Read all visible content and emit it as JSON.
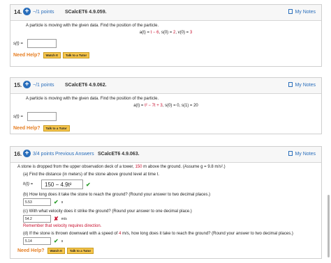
{
  "q14": {
    "num": "14.",
    "points": "−/1 points",
    "code": "SCalcET6 4.9.059.",
    "notes": "My Notes",
    "prompt": "A particle is moving with the given data. Find the position of the particle.",
    "eq_prefix": "a(t) = ",
    "eq_red1": "t − 6",
    "eq_mid": ",   s(0) = ",
    "eq_red2": "2",
    "eq_mid2": ",   v(0) = ",
    "eq_red3": "3",
    "ans_label": "s(t) =",
    "help": "Need Help?",
    "btn1": "Watch It",
    "btn2": "Talk to a Tutor"
  },
  "q15": {
    "num": "15.",
    "points": "−/1 points",
    "code": "SCalcET6 4.9.062.",
    "notes": "My Notes",
    "prompt": "A particle is moving with the given data. Find the position of the particle.",
    "eq_prefix": "a(t) = ",
    "eq_red1": "t² − 7t + 3",
    "eq_mid": ",   s(0) = 0,   s(1) = 20",
    "ans_label": "s(t) =",
    "help": "Need Help?",
    "btn1": "Talk to a Tutor"
  },
  "q16": {
    "num": "16.",
    "points": "3/4 points",
    "prev": "Previous Answers",
    "code": "SCalcET6 4.9.063.",
    "notes": "My Notes",
    "prompt_a": "A stone is dropped from the upper observation deck of a tower, ",
    "prompt_red": "150",
    "prompt_b": " m above the ground. (Assume g = 9.8 m/s².)",
    "pa": "(a) Find the distance (in meters) of the stone above ground level at time t.",
    "h_label": "h(t) =",
    "h_value": "150 − 4.9t²",
    "pb": "(b) How long does it take the stone to reach the ground? (Round your answer to two decimal places.)",
    "b_value": "5.53",
    "b_unit": "s",
    "pc": "(c) With what velocity does it strike the ground? (Round your answer to one decimal place.)",
    "c_value": "54.2",
    "c_unit": "m/s",
    "c_hint": "Remember that velocity requires direction.",
    "pd_a": "(d) If the stone is thrown downward with a speed of ",
    "pd_red": "4",
    "pd_b": " m/s, how long does it take to reach the ground? (Round your answer to two decimal places.)",
    "d_value": "5.14",
    "d_unit": "s",
    "help": "Need Help?",
    "btn1": "Watch It",
    "btn2": "Talk to a Tutor"
  },
  "icons": {
    "check": "✔",
    "cross": "✘"
  }
}
